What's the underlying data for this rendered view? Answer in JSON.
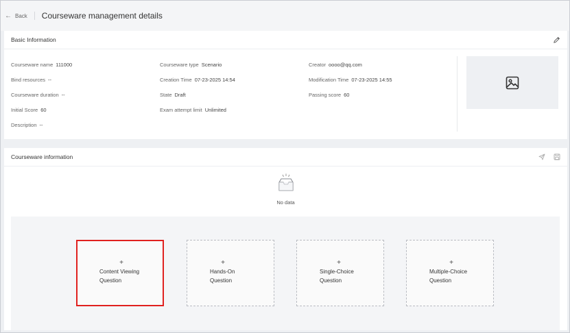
{
  "header": {
    "back_label": "Back",
    "title": "Courseware management details"
  },
  "basic": {
    "title": "Basic Information",
    "fields": {
      "name_label": "Courseware name",
      "name_value": "111000",
      "type_label": "Courseware type",
      "type_value": "Scenario",
      "creator_label": "Creator",
      "creator_value": "oooo@qq.com",
      "bind_label": "Bind resources",
      "bind_value": "--",
      "ctime_label": "Creation Time",
      "ctime_value": "07-23-2025 14:54",
      "mtime_label": "Modification Time",
      "mtime_value": "07-23-2025 14:55",
      "duration_label": "Courseware duration",
      "duration_value": "--",
      "state_label": "State",
      "state_value": "Draft",
      "passing_label": "Passing score",
      "passing_value": "60",
      "initial_label": "Initial Score",
      "initial_value": "60",
      "attempt_label": "Exam attempt limit",
      "attempt_value": "Unlimited",
      "desc_label": "Description",
      "desc_value": "--"
    }
  },
  "info": {
    "title": "Courseware information",
    "empty_text": "No data",
    "question_types": [
      {
        "plus": "+",
        "line1": "Content Viewing",
        "line2": "Question"
      },
      {
        "plus": "+",
        "line1": "Hands-On",
        "line2": "Question"
      },
      {
        "plus": "+",
        "line1": "Single-Choice",
        "line2": "Question"
      },
      {
        "plus": "+",
        "line1": "Multiple-Choice",
        "line2": "Question"
      }
    ]
  },
  "colors": {
    "highlight": "#e0201e",
    "page_bg": "#eef0f3"
  },
  "icons": {
    "back": "arrow-left-icon",
    "edit": "pencil-icon",
    "image": "image-icon",
    "send": "send-icon",
    "save": "save-icon",
    "empty": "empty-inbox-icon"
  }
}
